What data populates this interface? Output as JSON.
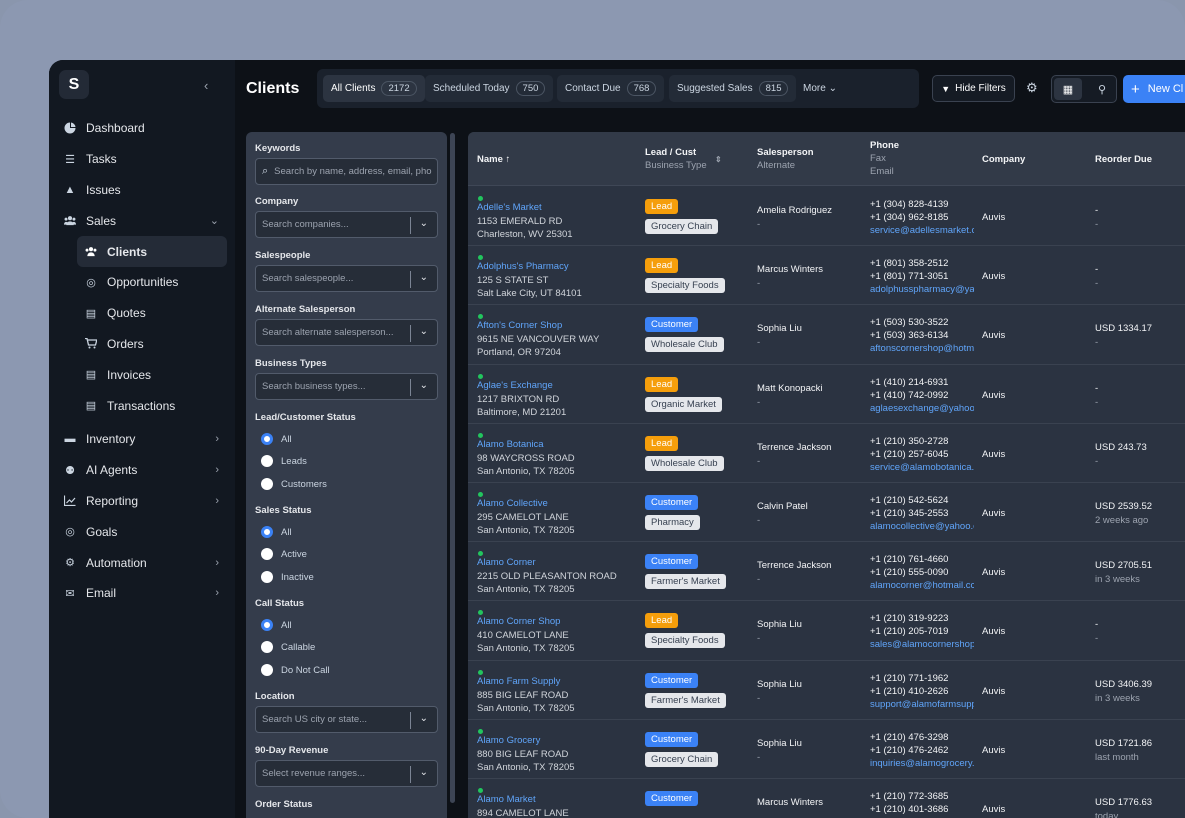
{
  "sidebar": {
    "logo": "S",
    "items": [
      {
        "label": "Dashboard",
        "icon": "pie-chart-icon",
        "chev": ""
      },
      {
        "label": "Tasks",
        "icon": "list-icon",
        "chev": ""
      },
      {
        "label": "Issues",
        "icon": "warning-icon",
        "chev": ""
      },
      {
        "label": "Sales",
        "icon": "users-icon",
        "chev": "⌄"
      }
    ],
    "sales_sub": [
      {
        "label": "Clients",
        "icon": "users-icon"
      },
      {
        "label": "Opportunities",
        "icon": "target-icon"
      },
      {
        "label": "Quotes",
        "icon": "document-icon"
      },
      {
        "label": "Orders",
        "icon": "cart-icon"
      },
      {
        "label": "Invoices",
        "icon": "document-icon"
      },
      {
        "label": "Transactions",
        "icon": "document-icon"
      }
    ],
    "lower": [
      {
        "label": "Inventory",
        "icon": "box-icon"
      },
      {
        "label": "AI Agents",
        "icon": "robot-icon"
      },
      {
        "label": "Reporting",
        "icon": "chart-icon"
      },
      {
        "label": "Goals",
        "icon": "target-icon"
      },
      {
        "label": "Automation",
        "icon": "gears-icon"
      },
      {
        "label": "Email",
        "icon": "mail-icon"
      }
    ]
  },
  "header": {
    "title": "Clients",
    "tabs": [
      {
        "label": "All Clients",
        "count": "2172"
      },
      {
        "label": "Scheduled Today",
        "count": "750"
      },
      {
        "label": "Contact Due",
        "count": "768"
      },
      {
        "label": "Suggested Sales",
        "count": "815"
      }
    ],
    "more": "More",
    "hide_filters": "Hide Filters",
    "new_button": "New Cl"
  },
  "filters": {
    "keywords_label": "Keywords",
    "keywords_placeholder": "Search by name, address, email, pho",
    "company_label": "Company",
    "company_placeholder": "Search companies...",
    "salespeople_label": "Salespeople",
    "salespeople_placeholder": "Search salespeople...",
    "alt_label": "Alternate Salesperson",
    "alt_placeholder": "Search alternate salesperson...",
    "btypes_label": "Business Types",
    "btypes_placeholder": "Search business types...",
    "lc_label": "Lead/Customer Status",
    "lc_options": [
      "All",
      "Leads",
      "Customers"
    ],
    "ss_label": "Sales Status",
    "ss_options": [
      "All",
      "Active",
      "Inactive"
    ],
    "cs_label": "Call Status",
    "cs_options": [
      "All",
      "Callable",
      "Do Not Call"
    ],
    "loc_label": "Location",
    "loc_placeholder": "Search US city or state...",
    "rev_label": "90-Day Revenue",
    "rev_placeholder": "Select revenue ranges...",
    "order_label": "Order Status"
  },
  "table": {
    "headers": {
      "name": "Name ↑",
      "lead": "Lead / Cust",
      "lead_sub": "Business Type",
      "sp": "Salesperson",
      "sp_sub": "Alternate",
      "phone": "Phone",
      "phone_sub1": "Fax",
      "phone_sub2": "Email",
      "company": "Company",
      "reorder": "Reorder Due"
    },
    "rows": [
      {
        "name": "Adelle's Market",
        "addr1": "1153 EMERALD RD",
        "addr2": "Charleston, WV 25301",
        "status": "Lead",
        "btype": "Grocery Chain",
        "sp": "Amelia Rodriguez",
        "alt": "-",
        "phone": "+1 (304) 828-4139",
        "fax": "+1 (304) 962-8185",
        "email": "service@adellesmarket.c",
        "company": "Auvis",
        "reorder": "-",
        "reorder2": "-"
      },
      {
        "name": "Adolphus's Pharmacy",
        "addr1": "125 S STATE ST",
        "addr2": "Salt Lake City, UT 84101",
        "status": "Lead",
        "btype": "Specialty Foods",
        "sp": "Marcus Winters",
        "alt": "-",
        "phone": "+1 (801) 358-2512",
        "fax": "+1 (801) 771-3051",
        "email": "adolphusspharmacy@ya",
        "company": "Auvis",
        "reorder": "-",
        "reorder2": "-"
      },
      {
        "name": "Afton's Corner Shop",
        "addr1": "9615 NE VANCOUVER WAY",
        "addr2": "Portland, OR 97204",
        "status": "Customer",
        "btype": "Wholesale Club",
        "sp": "Sophia Liu",
        "alt": "-",
        "phone": "+1 (503) 530-3522",
        "fax": "+1 (503) 363-6134",
        "email": "aftonscornershop@hotm",
        "company": "Auvis",
        "reorder": "USD 1334.17",
        "reorder2": "-"
      },
      {
        "name": "Aglae's Exchange",
        "addr1": "1217 BRIXTON RD",
        "addr2": "Baltimore, MD 21201",
        "status": "Lead",
        "btype": "Organic Market",
        "sp": "Matt Konopacki",
        "alt": "-",
        "phone": "+1 (410) 214-6931",
        "fax": "+1 (410) 742-0992",
        "email": "aglaesexchange@yahoo.",
        "company": "Auvis",
        "reorder": "-",
        "reorder2": "-"
      },
      {
        "name": "Alamo Botanica",
        "addr1": "98 WAYCROSS ROAD",
        "addr2": "San Antonio, TX 78205",
        "status": "Lead",
        "btype": "Wholesale Club",
        "sp": "Terrence Jackson",
        "alt": "-",
        "phone": "+1 (210) 350-2728",
        "fax": "+1 (210) 257-6045",
        "email": "service@alamobotanica.",
        "company": "Auvis",
        "reorder": "USD 243.73",
        "reorder2": "-"
      },
      {
        "name": "Alamo Collective",
        "addr1": "295 CAMELOT LANE",
        "addr2": "San Antonio, TX 78205",
        "status": "Customer",
        "btype": "Pharmacy",
        "sp": "Calvin Patel",
        "alt": "-",
        "phone": "+1 (210) 542-5624",
        "fax": "+1 (210) 345-2553",
        "email": "alamocollective@yahoo.c",
        "company": "Auvis",
        "reorder": "USD 2539.52",
        "reorder2": "2 weeks ago"
      },
      {
        "name": "Alamo Corner",
        "addr1": "2215 OLD PLEASANTON ROAD",
        "addr2": "San Antonio, TX 78205",
        "status": "Customer",
        "btype": "Farmer's Market",
        "sp": "Terrence Jackson",
        "alt": "-",
        "phone": "+1 (210) 761-4660",
        "fax": "+1 (210) 555-0090",
        "email": "alamocorner@hotmail.cc",
        "company": "Auvis",
        "reorder": "USD 2705.51",
        "reorder2": "in 3 weeks"
      },
      {
        "name": "Alamo Corner Shop",
        "addr1": "410 CAMELOT LANE",
        "addr2": "San Antonio, TX 78205",
        "status": "Lead",
        "btype": "Specialty Foods",
        "sp": "Sophia Liu",
        "alt": "-",
        "phone": "+1 (210) 319-9223",
        "fax": "+1 (210) 205-7019",
        "email": "sales@alamocornershop",
        "company": "Auvis",
        "reorder": "-",
        "reorder2": "-"
      },
      {
        "name": "Alamo Farm Supply",
        "addr1": "885 BIG LEAF ROAD",
        "addr2": "San Antonio, TX 78205",
        "status": "Customer",
        "btype": "Farmer's Market",
        "sp": "Sophia Liu",
        "alt": "-",
        "phone": "+1 (210) 771-1962",
        "fax": "+1 (210) 410-2626",
        "email": "support@alamofarmsupp",
        "company": "Auvis",
        "reorder": "USD 3406.39",
        "reorder2": "in 3 weeks"
      },
      {
        "name": "Alamo Grocery",
        "addr1": "880 BIG LEAF ROAD",
        "addr2": "San Antonio, TX 78205",
        "status": "Customer",
        "btype": "Grocery Chain",
        "sp": "Sophia Liu",
        "alt": "-",
        "phone": "+1 (210) 476-3298",
        "fax": "+1 (210) 476-2462",
        "email": "inquiries@alamogrocery.",
        "company": "Auvis",
        "reorder": "USD 1721.86",
        "reorder2": "last month"
      },
      {
        "name": "Alamo Market",
        "addr1": "894 CAMELOT LANE",
        "addr2": "",
        "status": "Customer",
        "btype": "",
        "sp": "Marcus Winters",
        "alt": "",
        "phone": "+1 (210) 772-3685",
        "fax": "+1 (210) 401-3686",
        "email": "",
        "company": "Auvis",
        "reorder": "USD 1776.63",
        "reorder2": "today"
      }
    ]
  }
}
